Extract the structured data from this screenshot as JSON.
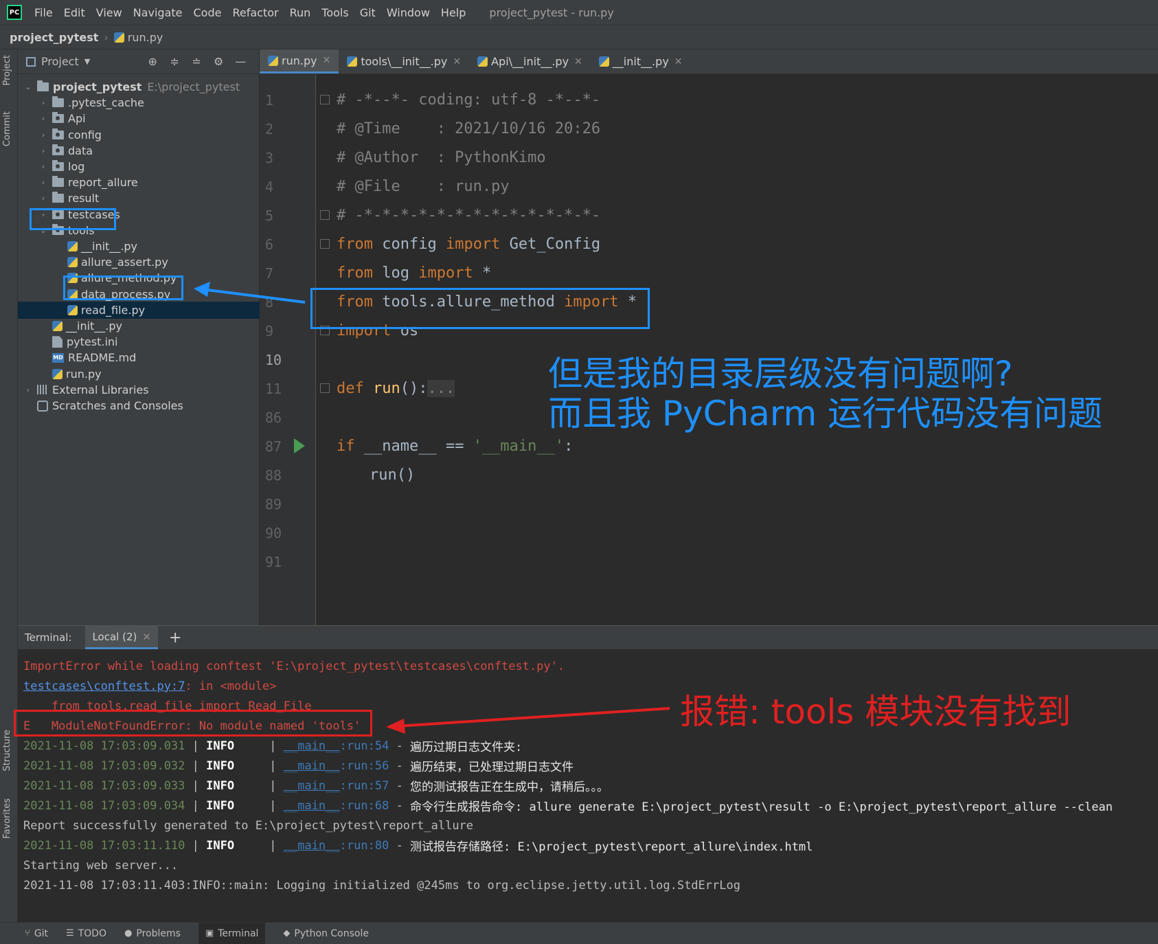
{
  "app": {
    "logo_text": "PC",
    "window_title": "project_pytest - run.py",
    "menu": [
      "File",
      "Edit",
      "View",
      "Navigate",
      "Code",
      "Refactor",
      "Run",
      "Tools",
      "Git",
      "Window",
      "Help"
    ]
  },
  "breadcrumb": {
    "root": "project_pytest",
    "file": "run.py"
  },
  "left_strip": {
    "project": "Project",
    "commit": "Commit",
    "structure": "Structure",
    "favorites": "Favorites"
  },
  "project_panel": {
    "title": "Project",
    "tree": [
      {
        "label": "project_pytest",
        "hint": "E:\\project_pytest",
        "kind": "folder",
        "expanded": true
      },
      {
        "label": ".pytest_cache",
        "kind": "folder"
      },
      {
        "label": "Api",
        "kind": "package"
      },
      {
        "label": "config",
        "kind": "package"
      },
      {
        "label": "data",
        "kind": "package"
      },
      {
        "label": "log",
        "kind": "package"
      },
      {
        "label": "report_allure",
        "kind": "folder"
      },
      {
        "label": "result",
        "kind": "folder"
      },
      {
        "label": "testcases",
        "kind": "package"
      },
      {
        "label": "tools",
        "kind": "package",
        "expanded": true
      },
      {
        "label": "__init__.py",
        "kind": "py"
      },
      {
        "label": "allure_assert.py",
        "kind": "py"
      },
      {
        "label": "allure_method.py",
        "kind": "py"
      },
      {
        "label": "data_process.py",
        "kind": "py"
      },
      {
        "label": "read_file.py",
        "kind": "py",
        "selected": true
      },
      {
        "label": "__init__.py",
        "kind": "py"
      },
      {
        "label": "pytest.ini",
        "kind": "ini"
      },
      {
        "label": "README.md",
        "kind": "md"
      },
      {
        "label": "run.py",
        "kind": "py"
      },
      {
        "label": "External Libraries",
        "kind": "lib"
      },
      {
        "label": "Scratches and Consoles",
        "kind": "scratch"
      }
    ]
  },
  "editor": {
    "tabs": [
      {
        "label": "run.py",
        "active": true
      },
      {
        "label": "tools\\__init__.py"
      },
      {
        "label": "Api\\__init__.py"
      },
      {
        "label": "__init__.py"
      }
    ],
    "line_numbers": [
      "1",
      "2",
      "3",
      "4",
      "5",
      "6",
      "7",
      "8",
      "9",
      "10",
      "11",
      "86",
      "87",
      "88",
      "89",
      "90",
      "91"
    ],
    "code": {
      "l1": "# -*--*- coding: utf-8 -*--*-",
      "l2": "# @Time    : 2021/10/16 20:26",
      "l3": "# @Author  : PythonKimo",
      "l4": "# @File    : run.py",
      "l5": "# -*-*-*-*-*-*-*-*-*-*-*-*-*-",
      "l6_kw1": "from",
      "l6_mod": " config ",
      "l6_kw2": "import",
      "l6_name": " Get_Config",
      "l7_kw1": "from",
      "l7_mod": " log ",
      "l7_kw2": "import",
      "l7_name": " *",
      "l8_kw1": "from",
      "l8_mod": " tools.allure_method ",
      "l8_kw2": "import",
      "l8_name": " *",
      "l9_kw": "import",
      "l9_name": " os",
      "l11_kw": "def",
      "l11_fn": " run",
      "l11_rest": "():",
      "l11_fold": "...",
      "l87_kw": "if",
      "l87_a": " __name__ == ",
      "l87_str": "'__main__'",
      "l87_b": ":",
      "l88": "run()"
    }
  },
  "terminal": {
    "label": "Terminal:",
    "tab": "Local (2)",
    "lines": {
      "err1": "ImportError while loading conftest 'E:\\project_pytest\\testcases\\conftest.py'.",
      "err2_link": "testcases\\conftest.py:7",
      "err2_rest": ": in <module>",
      "err3": "    from tools.read_file import Read_File",
      "err4": "E   ModuleNotFoundError: No module named 'tools'",
      "log_rows": [
        {
          "ts": "2021-11-08 17:03:09.031",
          "level": "INFO",
          "src": "__main__",
          "fn": "run",
          "line": "54",
          "msg": "遍历过期日志文件夹:"
        },
        {
          "ts": "2021-11-08 17:03:09.032",
          "level": "INFO",
          "src": "__main__",
          "fn": "run",
          "line": "56",
          "msg": "遍历结束，已处理过期日志文件"
        },
        {
          "ts": "2021-11-08 17:03:09.033",
          "level": "INFO",
          "src": "__main__",
          "fn": "run",
          "line": "57",
          "msg": "您的测试报告正在生成中，请稍后。。。"
        },
        {
          "ts": "2021-11-08 17:03:09.034",
          "level": "INFO",
          "src": "__main__",
          "fn": "run",
          "line": "68",
          "msg": "命令行生成报告命令: allure generate E:\\project_pytest\\result -o E:\\project_pytest\\report_allure --clean"
        }
      ],
      "report": "Report successfully generated to E:\\project_pytest\\report_allure",
      "log_row5": {
        "ts": "2021-11-08 17:03:11.110",
        "level": "INFO",
        "src": "__main__",
        "fn": "run",
        "line": "80",
        "msg": "测试报告存储路径: E:\\project_pytest\\report_allure\\index.html"
      },
      "starting": "Starting web server...",
      "jetty": "2021-11-08 17:03:11.403:INFO::main: Logging initialized @245ms to org.eclipse.jetty.util.log.StdErrLog"
    }
  },
  "statusbar": [
    "Git",
    "TODO",
    "Problems",
    "Terminal",
    "Python Console"
  ],
  "annotations": {
    "blue_line1": "但是我的目录层级没有问题啊?",
    "blue_line2": "而且我 PyCharm 运行代码没有问题",
    "red_text": "报错: tools 模块没有找到"
  },
  "colors": {
    "annotation_blue": "#1e90ff",
    "annotation_red": "#e02020",
    "accent": "#4a88c7"
  }
}
